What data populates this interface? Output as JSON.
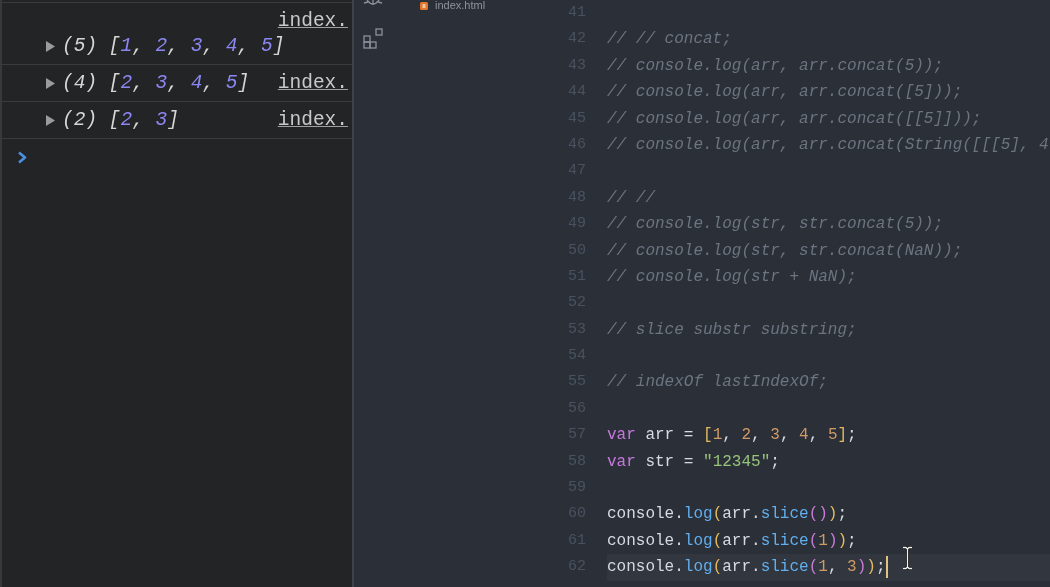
{
  "console": {
    "entries": [
      {
        "count": "(5)",
        "preview": [
          {
            "kind": "punctuation",
            "text": "["
          },
          {
            "kind": "number",
            "text": "1"
          },
          {
            "kind": "punctuation",
            "text": ", "
          },
          {
            "kind": "number",
            "text": "2"
          },
          {
            "kind": "punctuation",
            "text": ", "
          },
          {
            "kind": "number",
            "text": "3"
          },
          {
            "kind": "punctuation",
            "text": ", "
          },
          {
            "kind": "number",
            "text": "4"
          },
          {
            "kind": "punctuation",
            "text": ", "
          },
          {
            "kind": "number",
            "text": "5"
          },
          {
            "kind": "punctuation",
            "text": "]"
          }
        ],
        "source": "index.",
        "expanded": false
      },
      {
        "count": "(4)",
        "preview": [
          {
            "kind": "punctuation",
            "text": "["
          },
          {
            "kind": "number",
            "text": "2"
          },
          {
            "kind": "punctuation",
            "text": ", "
          },
          {
            "kind": "number",
            "text": "3"
          },
          {
            "kind": "punctuation",
            "text": ", "
          },
          {
            "kind": "number",
            "text": "4"
          },
          {
            "kind": "punctuation",
            "text": ", "
          },
          {
            "kind": "number",
            "text": "5"
          },
          {
            "kind": "punctuation",
            "text": "]"
          }
        ],
        "source": "index.",
        "expanded": false
      },
      {
        "count": "(2)",
        "preview": [
          {
            "kind": "punctuation",
            "text": "["
          },
          {
            "kind": "number",
            "text": "2"
          },
          {
            "kind": "punctuation",
            "text": ", "
          },
          {
            "kind": "number",
            "text": "3"
          },
          {
            "kind": "punctuation",
            "text": "]"
          }
        ],
        "source": "index.",
        "expanded": false
      }
    ]
  },
  "editor": {
    "explorer": {
      "files": [
        {
          "name": "index.html"
        }
      ]
    },
    "lines": [
      {
        "number": "41",
        "current": false
      },
      {
        "number": "42",
        "current": false,
        "tokens": [
          {
            "kind": "comment",
            "text": "// // concat;"
          }
        ]
      },
      {
        "number": "43",
        "current": false,
        "tokens": [
          {
            "kind": "comment",
            "text": "// console.log(arr, arr.concat(5));"
          }
        ]
      },
      {
        "number": "44",
        "current": false,
        "tokens": [
          {
            "kind": "comment",
            "text": "// console.log(arr, arr.concat([5]));"
          }
        ]
      },
      {
        "number": "45",
        "current": false,
        "tokens": [
          {
            "kind": "comment",
            "text": "// console.log(arr, arr.concat([[5]]));"
          }
        ]
      },
      {
        "number": "46",
        "current": false,
        "tokens": [
          {
            "kind": "comment",
            "text": "// console.log(arr, arr.concat(String([[[5], 4"
          }
        ]
      },
      {
        "number": "47",
        "current": false
      },
      {
        "number": "48",
        "current": false,
        "tokens": [
          {
            "kind": "comment",
            "text": "// //"
          }
        ]
      },
      {
        "number": "49",
        "current": false,
        "tokens": [
          {
            "kind": "comment",
            "text": "// console.log(str, str.concat(5));"
          }
        ]
      },
      {
        "number": "50",
        "current": false,
        "tokens": [
          {
            "kind": "comment",
            "text": "// console.log(str, str.concat(NaN));"
          }
        ]
      },
      {
        "number": "51",
        "current": false,
        "tokens": [
          {
            "kind": "comment",
            "text": "// console.log(str + NaN);"
          }
        ]
      },
      {
        "number": "52",
        "current": false
      },
      {
        "number": "53",
        "current": false,
        "tokens": [
          {
            "kind": "comment",
            "text": "// slice substr substring;"
          }
        ]
      },
      {
        "number": "54",
        "current": false
      },
      {
        "number": "55",
        "current": false,
        "tokens": [
          {
            "kind": "comment",
            "text": "// indexOf lastIndexOf;"
          }
        ]
      },
      {
        "number": "56",
        "current": false
      },
      {
        "number": "57",
        "current": false,
        "tokens": [
          {
            "kind": "keyword",
            "text": "var"
          },
          {
            "kind": "plain",
            "text": " arr = "
          },
          {
            "kind": "bracket1",
            "text": "["
          },
          {
            "kind": "number",
            "text": "1"
          },
          {
            "kind": "plain",
            "text": ", "
          },
          {
            "kind": "number",
            "text": "2"
          },
          {
            "kind": "plain",
            "text": ", "
          },
          {
            "kind": "number",
            "text": "3"
          },
          {
            "kind": "plain",
            "text": ", "
          },
          {
            "kind": "number",
            "text": "4"
          },
          {
            "kind": "plain",
            "text": ", "
          },
          {
            "kind": "number",
            "text": "5"
          },
          {
            "kind": "bracket1",
            "text": "]"
          },
          {
            "kind": "plain",
            "text": ";"
          }
        ]
      },
      {
        "number": "58",
        "current": false,
        "tokens": [
          {
            "kind": "keyword",
            "text": "var"
          },
          {
            "kind": "plain",
            "text": " str = "
          },
          {
            "kind": "string",
            "text": "\"12345\""
          },
          {
            "kind": "plain",
            "text": ";"
          }
        ]
      },
      {
        "number": "59",
        "current": false
      },
      {
        "number": "60",
        "current": false,
        "tokens": [
          {
            "kind": "plain",
            "text": "console."
          },
          {
            "kind": "method",
            "text": "log"
          },
          {
            "kind": "bracket1",
            "text": "("
          },
          {
            "kind": "plain",
            "text": "arr."
          },
          {
            "kind": "method",
            "text": "slice"
          },
          {
            "kind": "bracket2",
            "text": "()"
          },
          {
            "kind": "bracket1",
            "text": ")"
          },
          {
            "kind": "plain",
            "text": ";"
          }
        ]
      },
      {
        "number": "61",
        "current": false,
        "tokens": [
          {
            "kind": "plain",
            "text": "console."
          },
          {
            "kind": "method",
            "text": "log"
          },
          {
            "kind": "bracket1",
            "text": "("
          },
          {
            "kind": "plain",
            "text": "arr."
          },
          {
            "kind": "method",
            "text": "slice"
          },
          {
            "kind": "bracket2",
            "text": "("
          },
          {
            "kind": "number",
            "text": "1"
          },
          {
            "kind": "bracket2",
            "text": ")"
          },
          {
            "kind": "bracket1",
            "text": ")"
          },
          {
            "kind": "plain",
            "text": ";"
          }
        ]
      },
      {
        "number": "62",
        "current": true,
        "tokens": [
          {
            "kind": "plain",
            "text": "console."
          },
          {
            "kind": "method",
            "text": "log"
          },
          {
            "kind": "bracket1",
            "text": "("
          },
          {
            "kind": "plain",
            "text": "arr."
          },
          {
            "kind": "method",
            "text": "slice"
          },
          {
            "kind": "bracket2",
            "text": "("
          },
          {
            "kind": "number",
            "text": "1"
          },
          {
            "kind": "plain",
            "text": ", "
          },
          {
            "kind": "number",
            "text": "3"
          },
          {
            "kind": "bracket2",
            "text": ")"
          },
          {
            "kind": "bracket1",
            "text": ")"
          },
          {
            "kind": "plain",
            "text": ";"
          }
        ]
      }
    ]
  }
}
